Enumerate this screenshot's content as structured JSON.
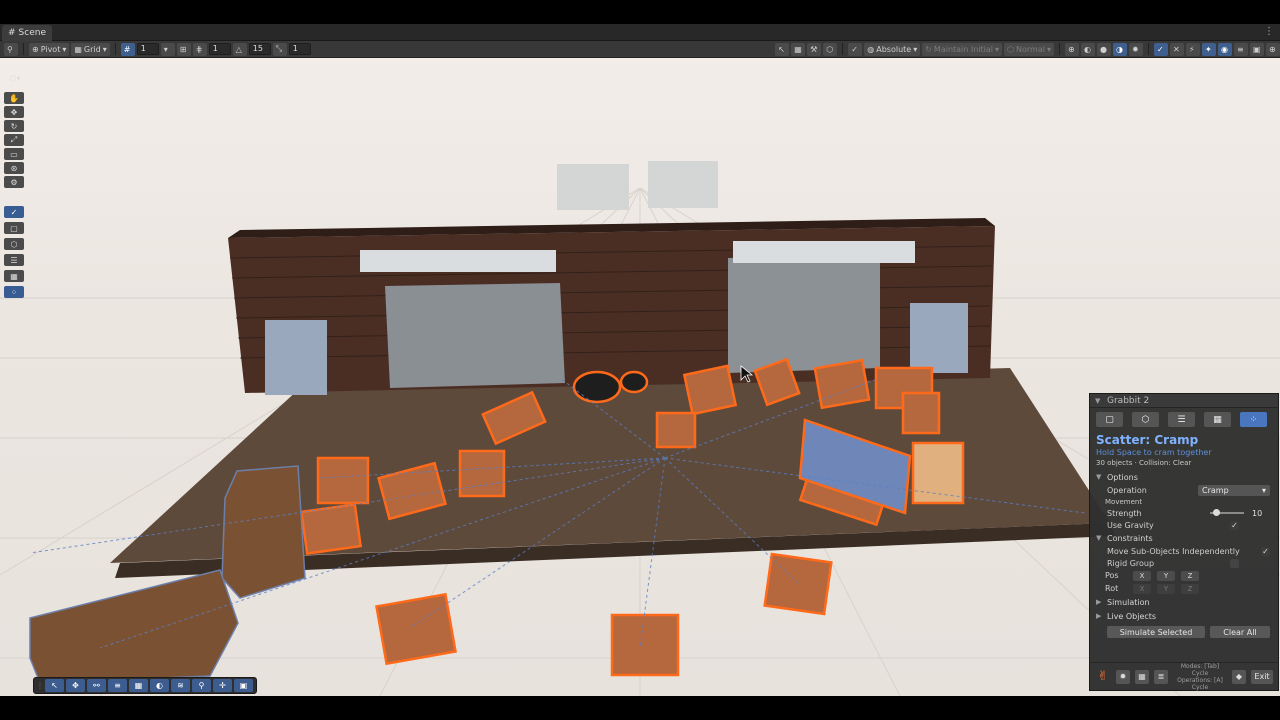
{
  "tab": {
    "icon": "scene-hash-icon",
    "label": "Scene"
  },
  "toolbar": {
    "pivot_label": "Pivot",
    "grid_label": "Grid",
    "grid_size_1": "1",
    "grid_size_2": "1",
    "angle_snap": "15",
    "scale_snap": "1",
    "absolute_label": "Absolute",
    "maintain_label": "Maintain Initial",
    "normal_label": "Normal"
  },
  "panel": {
    "header": "Grabbit 2",
    "title": "Scatter: Cramp",
    "hint": "Hold Space to cram together",
    "info": "30 objects · Collision: Clear",
    "options_label": "Options",
    "operation_label": "Operation",
    "operation_value": "Cramp",
    "movement_label": "Movement",
    "strength_label": "Strength",
    "strength_value": "10",
    "strength_fraction": 0.2,
    "gravity_label": "Use Gravity",
    "constraints_label": "Constraints",
    "move_sub_label": "Move Sub-Objects Independently",
    "rigid_label": "Rigid Group",
    "pos_label": "Pos",
    "rot_label": "Rot",
    "axis_x": "X",
    "axis_y": "Y",
    "axis_z": "Z",
    "simulation_label": "Simulation",
    "live_label": "Live Objects",
    "simulate_btn": "Simulate Selected",
    "clear_btn": "Clear All",
    "modes_text": "Modes: [Tab]",
    "cycle_text_1": "Cycle",
    "operations_text": "Operations: [A]",
    "cycle_text_2": "Cycle",
    "exit_btn": "Exit"
  },
  "colors": {
    "accent": "#4a76c0",
    "title": "#7fb2ff",
    "selection": "#ff6a1a"
  }
}
